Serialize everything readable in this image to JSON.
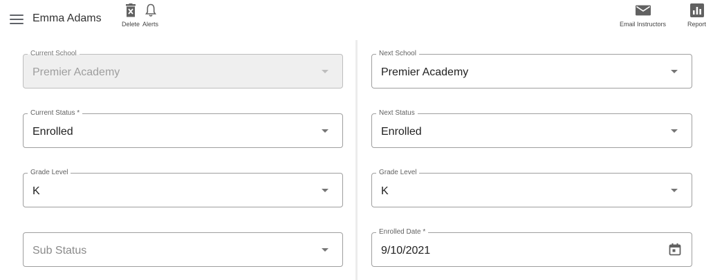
{
  "toolbar": {
    "student_name": "Emma Adams",
    "delete_label": "Delete",
    "alerts_label": "Alerts",
    "email_label": "Email Instructors",
    "report_label": "Report",
    "icons": [
      "menu-icon",
      "trash-icon",
      "bell-icon",
      "mail-icon",
      "bar-chart-icon"
    ],
    "icon_color": "#616161"
  },
  "left_form": {
    "current_school": {
      "label": "Current School",
      "value": "Premier Academy"
    },
    "current_status": {
      "label": "Current Status *",
      "value": "Enrolled"
    },
    "grade_level": {
      "label": "Grade Level",
      "value": "K"
    },
    "sub_status": {
      "placeholder": "Sub Status"
    }
  },
  "right_form": {
    "next_school": {
      "label": "Next School",
      "value": "Premier Academy"
    },
    "next_status": {
      "label": "Next Status",
      "value": "Enrolled"
    },
    "grade_level": {
      "label": "Grade Level",
      "value": "K"
    },
    "enrolled_date": {
      "label": "Enrolled Date *",
      "value": "9/10/2021"
    }
  }
}
